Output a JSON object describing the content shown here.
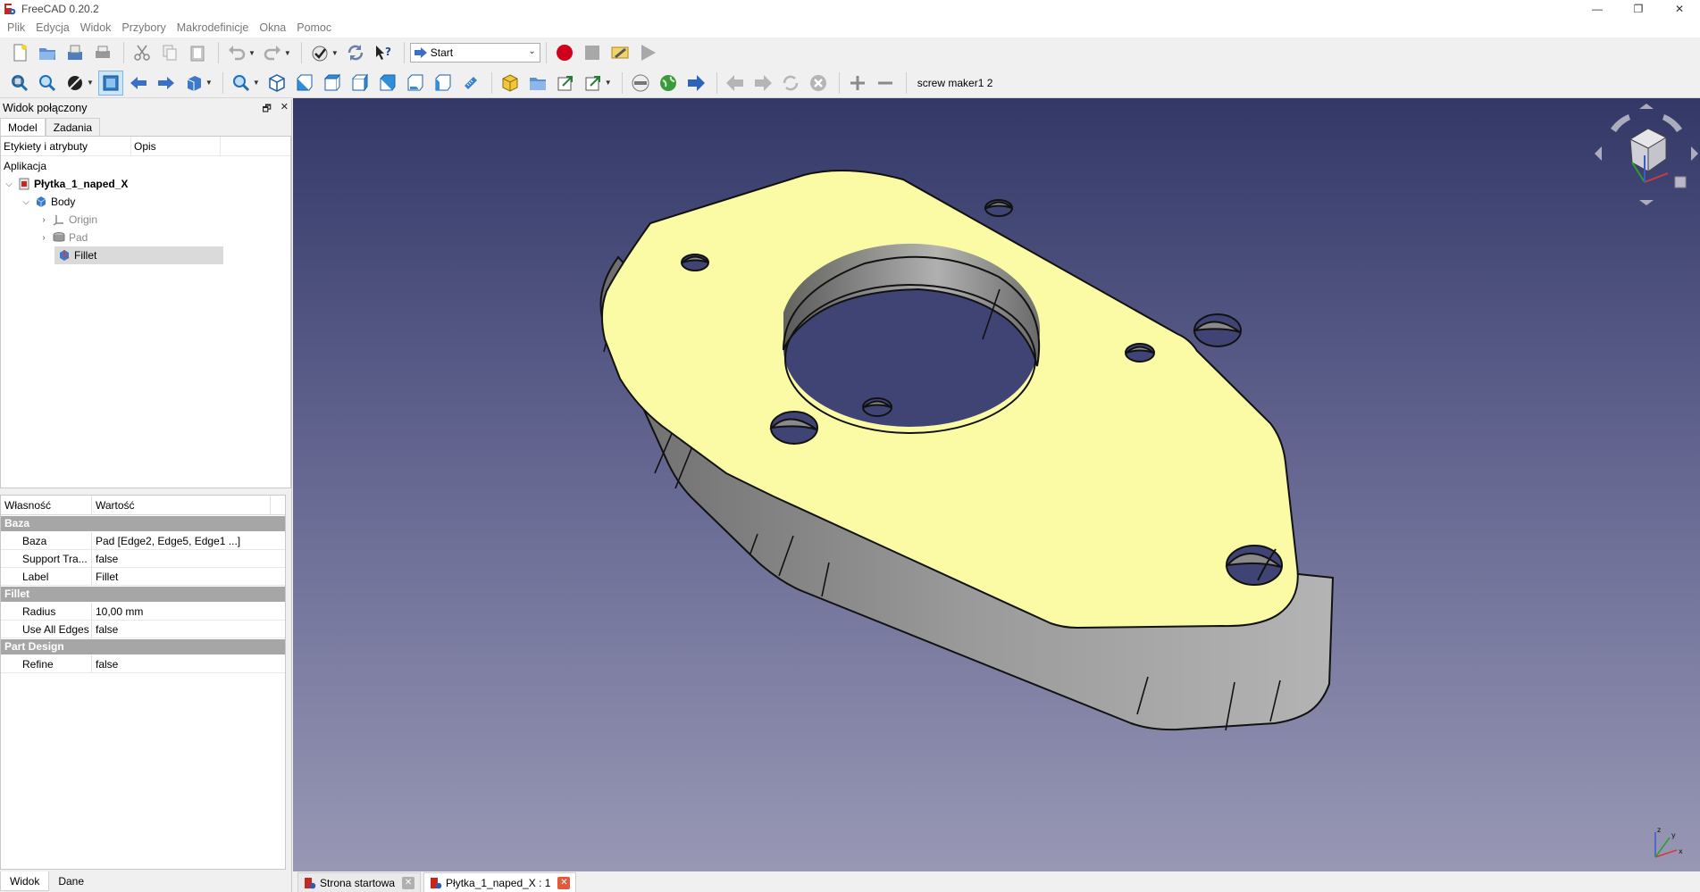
{
  "window": {
    "title": "FreeCAD 0.20.2",
    "controls": [
      "—",
      "❐",
      "✕"
    ]
  },
  "menu": [
    "Plik",
    "Edycja",
    "Widok",
    "Przybory",
    "Makrodefinicje",
    "Okna",
    "Pomoc"
  ],
  "toolbar1": {
    "workbench": "Start"
  },
  "toolbar2": {
    "macro_label": "screw maker1 2"
  },
  "combo": {
    "title": "Widok połączony",
    "tabs": [
      "Model",
      "Zadania"
    ],
    "tree_columns": [
      "Etykiety i atrybuty",
      "Opis"
    ],
    "tree_root": "Aplikacja",
    "tree": [
      {
        "label": "Płytka_1_naped_X",
        "bold": true
      },
      {
        "label": "Body"
      },
      {
        "label": "Origin"
      },
      {
        "label": "Pad"
      },
      {
        "label": "Fillet"
      }
    ],
    "prop_columns": [
      "Własność",
      "Wartość"
    ],
    "props": {
      "group_base": "Baza",
      "base": [
        {
          "name": "Baza",
          "value": "Pad [Edge2, Edge5, Edge1 ...]"
        },
        {
          "name": "Support Tra...",
          "value": "false"
        },
        {
          "name": "Label",
          "value": "Fillet"
        }
      ],
      "group_fillet": "Fillet",
      "fillet": [
        {
          "name": "Radius",
          "value": "10,00 mm"
        },
        {
          "name": "Use All Edges",
          "value": "false"
        }
      ],
      "group_pd": "Part Design",
      "pd": [
        {
          "name": "Refine",
          "value": "false"
        }
      ]
    },
    "bottom_tabs": [
      "Widok",
      "Dane"
    ]
  },
  "doc_tabs": [
    "Strona startowa",
    "Płytka_1_naped_X : 1"
  ],
  "colors": {
    "top_face": "#fbfba6",
    "bg_top": "#333867",
    "bg_bottom": "#9898b5",
    "record": "#d0021b"
  }
}
